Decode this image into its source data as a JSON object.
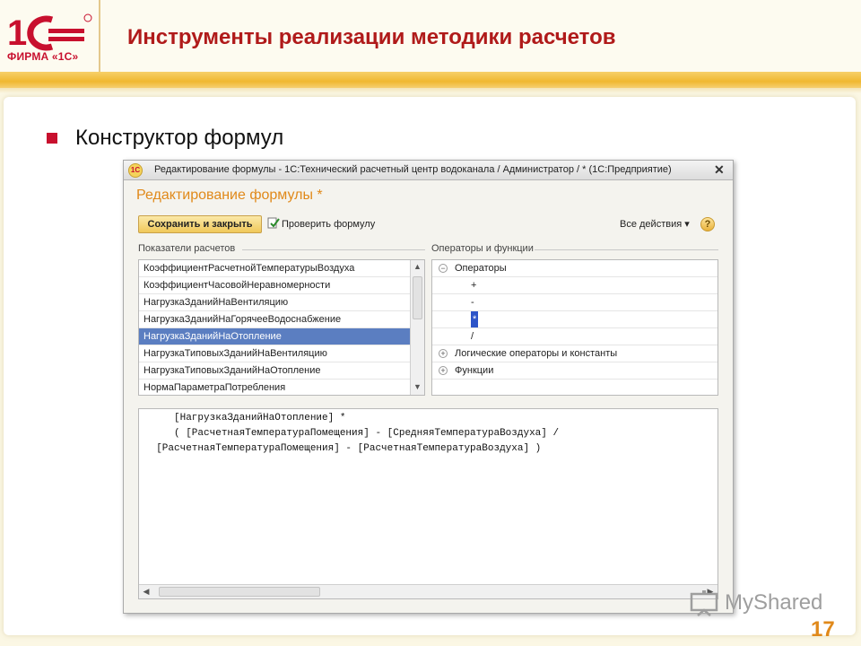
{
  "brand": {
    "logo_text": "ФИРМА «1С»",
    "logo_mark": "1С",
    "red": "#c8102e",
    "gold": "#f0b830"
  },
  "slide": {
    "title": "Инструменты реализации методики расчетов",
    "bullet": "Конструктор формул",
    "page_number": "17"
  },
  "window": {
    "title": "Редактирование формулы - 1С:Технический расчетный центр водоканала / Администратор / * (1С:Предприятие)",
    "icon_text": "1C",
    "close_symbol": "✕",
    "form_title": "Редактирование формулы *",
    "toolbar": {
      "save_label": "Сохранить и закрыть",
      "check_label": "Проверить формулу",
      "all_actions_label": "Все действия ▾",
      "help_symbol": "?"
    },
    "left_group_label": "Показатели расчетов",
    "right_group_label": "Операторы и функции",
    "indicators": [
      "КоэффициентРасчетнойТемпературыВоздуха",
      "КоэффициентЧасовойНеравномерности",
      "НагрузкаЗданийНаВентиляцию",
      "НагрузкаЗданийНаГорячееВодоснабжение",
      "НагрузкаЗданийНаОтопление",
      "НагрузкаТиповыхЗданийНаВентиляцию",
      "НагрузкаТиповыхЗданийНаОтопление",
      "НормаПараметраПотребления"
    ],
    "selected_indicator": "НагрузкаЗданийНаОтопление",
    "tree": {
      "operators_label": "Операторы",
      "operators_toggle": "−",
      "operators": [
        "+",
        "-",
        "*",
        "/"
      ],
      "selected_operator": "*",
      "logical_label": "Логические операторы и константы",
      "functions_label": "Функции",
      "collapsed_toggle": "+"
    },
    "formula_lines": [
      "     [НагрузкаЗданийНаОтопление] *",
      "     ( [РасчетнаяТемператураПомещения] - [СредняяТемператураВоздуха] /",
      "  [РасчетнаяТемператураПомещения] - [РасчетнаяТемператураВоздуха] )"
    ]
  },
  "watermark": {
    "text": "MyShared"
  }
}
